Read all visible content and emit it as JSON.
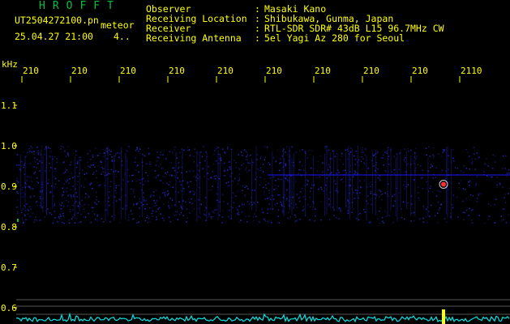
{
  "header": {
    "app_name": "HROFFT",
    "filename": "UT2504272100.pn",
    "mode_label": "meteor",
    "datetime": "25.04.27 21:00",
    "count": "4..",
    "fields": [
      {
        "label": "Observer",
        "value": "Masaki Kano"
      },
      {
        "label": "Receiving Location",
        "value": "Shibukawa, Gunma, Japan"
      },
      {
        "label": "Receiver",
        "value": "RTL-SDR SDR# 43dB L15 96.7MHz CW"
      },
      {
        "label": "Receiving Antenna",
        "value": "5el Yagi Az 280 for Seoul"
      }
    ],
    "colon": ":"
  },
  "colors": {
    "background": "#000000",
    "text": "#ffff00",
    "title": "#00c040",
    "signal": "#1a1aff",
    "power_trace": "#00e5e5"
  },
  "chart_data": {
    "type": "heatmap",
    "ylabel": "kHz",
    "time_ticks": [
      "210",
      "210",
      "210",
      "210",
      "210",
      "210",
      "210",
      "210",
      "210",
      "2110"
    ],
    "freq_ticks": [
      "1.1",
      "1.0",
      "0.9",
      "0.8",
      "0.7",
      "0.6"
    ],
    "freq_tick_values": [
      1.1,
      1.0,
      0.9,
      0.8,
      0.7,
      0.6
    ],
    "ylim": [
      0.59,
      1.12
    ],
    "noise_band_khz": [
      0.81,
      1.0
    ],
    "carrier_khz": 0.928,
    "echo_khz": 0.905
  }
}
